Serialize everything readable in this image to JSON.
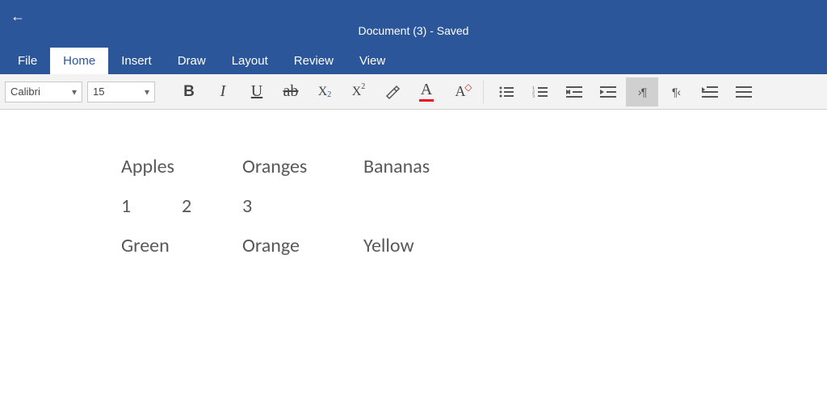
{
  "title": "Document (3) - Saved",
  "menu": {
    "tabs": [
      "File",
      "Home",
      "Insert",
      "Draw",
      "Layout",
      "Review",
      "View"
    ],
    "active": "Home"
  },
  "ribbon": {
    "font_name": "Calibri",
    "font_size": "15"
  },
  "document": {
    "rows": [
      [
        "Apples",
        "Oranges",
        "Bananas"
      ],
      [
        "1",
        "2",
        "3"
      ],
      [
        "Green",
        "Orange",
        "Yellow"
      ]
    ]
  }
}
